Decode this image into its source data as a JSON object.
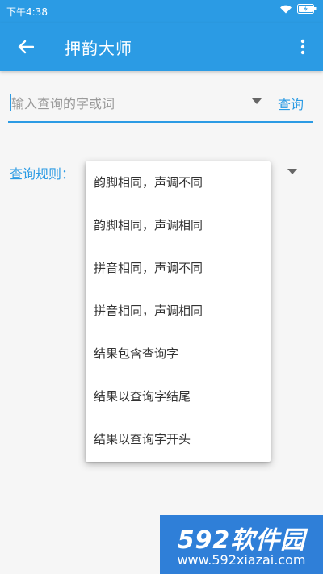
{
  "status_bar": {
    "time": "下午4:38"
  },
  "app_bar": {
    "title": "押韵大师"
  },
  "search": {
    "placeholder": "输入查询的字或词",
    "value": "",
    "button_label": "查询"
  },
  "rule": {
    "label": "查询规则："
  },
  "menu": {
    "items": [
      "韵脚相同，声调不同",
      "韵脚相同，声调相同",
      "拼音相同，声调不同",
      "拼音相同，声调相同",
      "结果包含查询字",
      "结果以查询字结尾",
      "结果以查询字开头"
    ]
  },
  "watermark": {
    "logo": "592软件园",
    "url": "www.592xiazai.com"
  },
  "colors": {
    "primary": "#2b9be4",
    "watermark_bg": "#2f7fd8"
  }
}
